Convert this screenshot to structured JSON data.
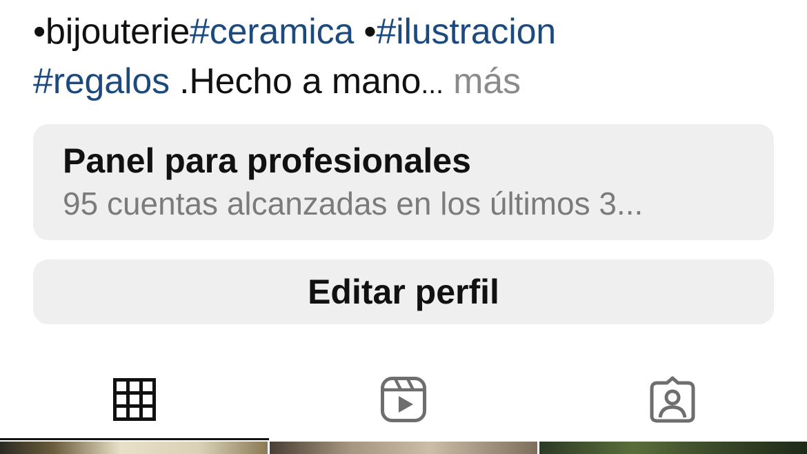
{
  "bio": {
    "line1": {
      "bullet": "•",
      "word": "bijouterie",
      "tag1": "#ceramica",
      "sep": " •",
      "tag2": "#ilustracion"
    },
    "line2": {
      "tag": "#regalos",
      "text": " .Hecho a mano",
      "ellipsis": "...",
      "more": " más"
    }
  },
  "pro_panel": {
    "title": "Panel para profesionales",
    "subtitle": "95 cuentas alcanzadas en los últimos 3..."
  },
  "edit_profile": {
    "label": "Editar perfil"
  },
  "tabs": [
    {
      "icon": "grid-icon",
      "active": true
    },
    {
      "icon": "reels-icon",
      "active": false
    },
    {
      "icon": "tagged-icon",
      "active": false
    }
  ],
  "colors": {
    "hashtag": "#1d4a7e",
    "muted": "#8b8b8b",
    "card_bg": "#efefef"
  }
}
